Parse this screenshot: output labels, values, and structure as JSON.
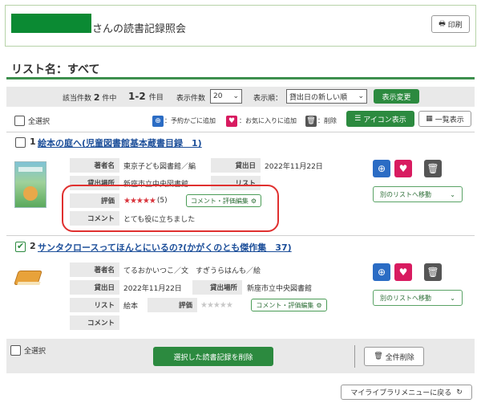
{
  "header": {
    "title": "さんの読書記録照会",
    "print_label": "印刷"
  },
  "list_name": "リスト名：すべて",
  "counts": {
    "total_label": "該当件数",
    "total_value": "2",
    "total_unit": "件中",
    "range_value": "1-2",
    "range_unit": "件目",
    "per_page_label": "表示件数",
    "per_page_value": "20",
    "sort_label": "表示順：",
    "sort_value": "貸出日の新しい順",
    "apply_label": "表示変更"
  },
  "actions": {
    "select_all": "全選択",
    "cart_label": "：予約かごに追加",
    "fav_label": "：お気に入りに追加",
    "delete_label": "：削除",
    "icon_view": "アイコン表示",
    "list_view": "一覧表示"
  },
  "labels": {
    "author": "著者名",
    "loan_date": "貸出日",
    "loan_place": "貸出場所",
    "list": "リスト",
    "rating": "評価",
    "comment": "コメント",
    "comment_edit": "コメント・評価編集",
    "move_list": "別のリストへ移動"
  },
  "records": [
    {
      "num": "1",
      "title": "絵本の庭へ(児童図書館基本蔵書目録　1)",
      "author": "東京子ども図書館／編",
      "loan_date": "2022年11月22日",
      "loan_place": "新座市立中央図書館",
      "list": "",
      "rating_text": "★★★★★",
      "rating_count": "(5)",
      "comment": "とても役に立ちました",
      "checked": false
    },
    {
      "num": "2",
      "title": "サンタクロースってほんとにいるの?(かがくのとも傑作集　37)",
      "author": "てるおかいつこ／文　すぎうらはんも／絵",
      "loan_date": "2022年11月22日",
      "loan_place": "新座市立中央図書館",
      "list": "絵本",
      "rating_text": "★★★★★",
      "comment": "",
      "checked": true
    }
  ],
  "footer": {
    "select_all": "全選択",
    "delete_selected": "選択した読書記録を削除",
    "delete_all": "全件削除",
    "back_label": "マイライブラリメニューに戻る"
  },
  "colors": {
    "accent_green": "#2c8a3f",
    "link_blue": "#1d4f9a",
    "star_red": "#d9343c",
    "highlight_red": "#e0302f"
  }
}
